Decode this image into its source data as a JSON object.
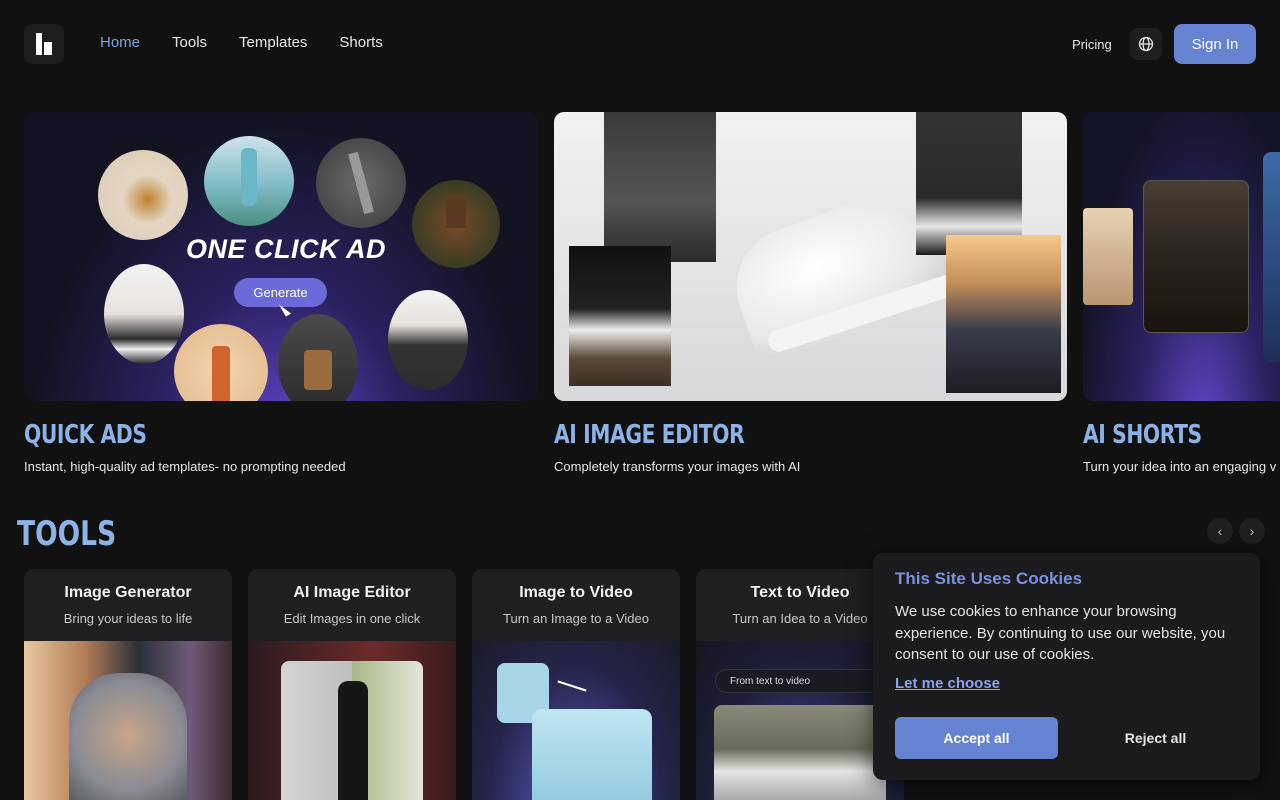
{
  "header": {
    "nav": [
      {
        "label": "Home",
        "active": true
      },
      {
        "label": "Tools",
        "active": false
      },
      {
        "label": "Templates",
        "active": false
      },
      {
        "label": "Shorts",
        "active": false
      }
    ],
    "pricing_label": "Pricing",
    "signin_label": "Sign In",
    "accent_color": "#6683d2"
  },
  "hero": {
    "cards": [
      {
        "title": "QUICK ADS",
        "desc": "Instant, high-quality ad templates- no prompting needed",
        "overlay_title": "ONE CLICK AD",
        "button_label": "Generate"
      },
      {
        "title": "AI IMAGE EDITOR",
        "desc": "Completely transforms your images with AI"
      },
      {
        "title": "AI SHORTS",
        "desc": "Turn your idea into an engaging v"
      }
    ]
  },
  "tools": {
    "title": "TOOLS",
    "items": [
      {
        "name": "Image Generator",
        "desc": "Bring your ideas to life"
      },
      {
        "name": "AI Image Editor",
        "desc": "Edit Images in one click"
      },
      {
        "name": "Image to Video",
        "desc": "Turn an Image to a Video"
      },
      {
        "name": "Text to Video",
        "desc": "Turn an Idea to a Video",
        "prompt_text": "From text to video"
      }
    ],
    "prev_icon": "chevron-left-icon",
    "next_icon": "chevron-right-icon"
  },
  "cookie": {
    "title": "This Site Uses Cookies",
    "text": "We use cookies to enhance your browsing experience. By continuing to use our website, you consent to our use of cookies.",
    "link": "Let me choose",
    "accept": "Accept all",
    "reject": "Reject all"
  }
}
